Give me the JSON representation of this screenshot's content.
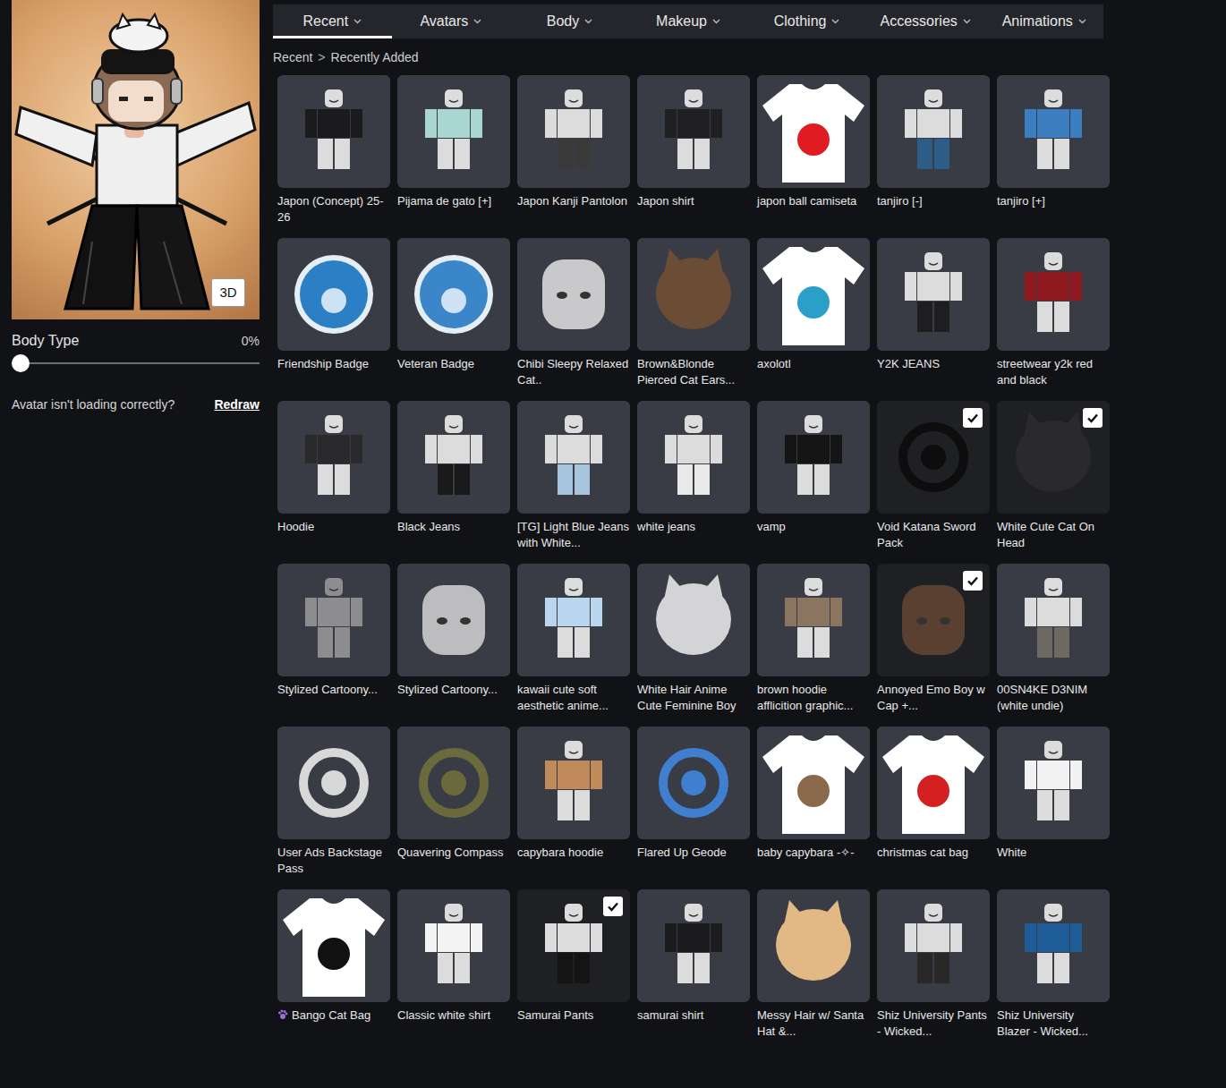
{
  "preview": {
    "button": "3D"
  },
  "body_type": {
    "label": "Body Type",
    "reading": "0%",
    "level": 0
  },
  "help": {
    "text": "Avatar isn't loading correctly?",
    "link": "Redraw"
  },
  "tabs": [
    {
      "label": "Recent",
      "selected": true
    },
    {
      "label": "Avatars",
      "selected": false
    },
    {
      "label": "Body",
      "selected": false
    },
    {
      "label": "Makeup",
      "selected": false
    },
    {
      "label": "Clothing",
      "selected": false
    },
    {
      "label": "Accessories",
      "selected": false
    },
    {
      "label": "Animations",
      "selected": false
    }
  ],
  "breadcrumb": {
    "items": [
      "Recent",
      "Recently Added"
    ],
    "separator": ">"
  },
  "items": [
    {
      "name": "Japon (Concept) 25-26",
      "equipped": false,
      "kind": "shirt",
      "color": "#1b1b1d"
    },
    {
      "name": "Pijama de gato [+]",
      "equipped": false,
      "kind": "shirt",
      "color": "#a9d6d0"
    },
    {
      "name": "Japon Kanji Pantolon",
      "equipped": false,
      "kind": "pants",
      "color": "#3a3a3a"
    },
    {
      "name": "Japon shirt",
      "equipped": false,
      "kind": "shirt",
      "color": "#202022"
    },
    {
      "name": "japon ball camiseta",
      "equipped": false,
      "kind": "tshirt",
      "color": "#e11b22"
    },
    {
      "name": "tanjiro [-]",
      "equipped": false,
      "kind": "pants",
      "color": "#2c5d86"
    },
    {
      "name": "tanjiro [+]",
      "equipped": false,
      "kind": "shirt",
      "color": "#3b7fc0"
    },
    {
      "name": "Friendship Badge",
      "equipped": false,
      "kind": "badge",
      "color": "#2b7fc4"
    },
    {
      "name": "Veteran Badge",
      "equipped": false,
      "kind": "badge",
      "color": "#3a86c8"
    },
    {
      "name": "Chibi Sleepy Relaxed Cat..",
      "equipped": false,
      "kind": "head",
      "color": "#c9c9cb"
    },
    {
      "name": "Brown&Blonde Pierced Cat Ears...",
      "equipped": false,
      "kind": "hair",
      "color": "#6b4d36"
    },
    {
      "name": "axolotl",
      "equipped": false,
      "kind": "tshirt",
      "color": "#2aa0c8"
    },
    {
      "name": "Y2K JEANS",
      "equipped": false,
      "kind": "pants",
      "color": "#1e1e20"
    },
    {
      "name": "streetwear y2k red and black",
      "equipped": false,
      "kind": "shirt",
      "color": "#8c1a1f"
    },
    {
      "name": "Hoodie",
      "equipped": false,
      "kind": "shirt",
      "color": "#2a2a2c"
    },
    {
      "name": "Black Jeans",
      "equipped": false,
      "kind": "pants",
      "color": "#1a1a1b"
    },
    {
      "name": "[TG] Light Blue Jeans with White...",
      "equipped": false,
      "kind": "pants",
      "color": "#a7c6dd"
    },
    {
      "name": "white jeans",
      "equipped": false,
      "kind": "pants",
      "color": "#e9e9e9"
    },
    {
      "name": "vamp",
      "equipped": false,
      "kind": "shirt",
      "color": "#151516"
    },
    {
      "name": "Void Katana Sword Pack",
      "equipped": true,
      "kind": "accessory",
      "color": "#0d0d0e"
    },
    {
      "name": "White Cute Cat On Head",
      "equipped": true,
      "kind": "hair",
      "color": "#2a2a2d"
    },
    {
      "name": "Stylized Cartoony...",
      "equipped": false,
      "kind": "body",
      "color": "#8d8d90"
    },
    {
      "name": "Stylized Cartoony...",
      "equipped": false,
      "kind": "head",
      "color": "#bdbdbf"
    },
    {
      "name": "kawaii cute soft aesthetic anime...",
      "equipped": false,
      "kind": "shirt",
      "color": "#b9d6ee"
    },
    {
      "name": "White Hair Anime Cute Feminine Boy",
      "equipped": false,
      "kind": "hair",
      "color": "#d4d4d6"
    },
    {
      "name": "brown hoodie afflicition graphic...",
      "equipped": false,
      "kind": "shirt",
      "color": "#8b7560"
    },
    {
      "name": "Annoyed Emo Boy w Cap +...",
      "equipped": true,
      "kind": "head",
      "color": "#5a4030"
    },
    {
      "name": "00SN4KE D3NIM (white undie)",
      "equipped": false,
      "kind": "pants",
      "color": "#6e6a62"
    },
    {
      "name": "User Ads Backstage Pass",
      "equipped": false,
      "kind": "accessory",
      "color": "#d8d8d8"
    },
    {
      "name": "Quavering Compass",
      "equipped": false,
      "kind": "accessory",
      "color": "#6b6a3c"
    },
    {
      "name": "capybara hoodie",
      "equipped": false,
      "kind": "shirt",
      "color": "#c08a5a"
    },
    {
      "name": "Flared Up Geode",
      "equipped": false,
      "kind": "accessory",
      "color": "#3f7fd0"
    },
    {
      "name": "baby capybara -✧-",
      "equipped": false,
      "kind": "tshirt",
      "color": "#8a6a4a"
    },
    {
      "name": "christmas cat bag",
      "equipped": false,
      "kind": "tshirt",
      "color": "#d42020"
    },
    {
      "name": "White",
      "equipped": false,
      "kind": "shirt",
      "color": "#f2f2f2"
    },
    {
      "name": "Bango Cat Bag",
      "equipped": false,
      "kind": "tshirt",
      "color": "#111111"
    },
    {
      "name": "Classic white shirt",
      "equipped": false,
      "kind": "shirt",
      "color": "#f4f4f4"
    },
    {
      "name": "Samurai Pants",
      "equipped": true,
      "kind": "pants",
      "color": "#141415"
    },
    {
      "name": "samurai shirt",
      "equipped": false,
      "kind": "shirt",
      "color": "#1c1c1e"
    },
    {
      "name": "Messy Hair w/ Santa Hat &...",
      "equipped": false,
      "kind": "hair",
      "color": "#e2b884"
    },
    {
      "name": "Shiz University Pants - Wicked...",
      "equipped": false,
      "kind": "pants",
      "color": "#2a2826"
    },
    {
      "name": "Shiz University Blazer - Wicked...",
      "equipped": false,
      "kind": "shirt",
      "color": "#1f5d98"
    }
  ]
}
